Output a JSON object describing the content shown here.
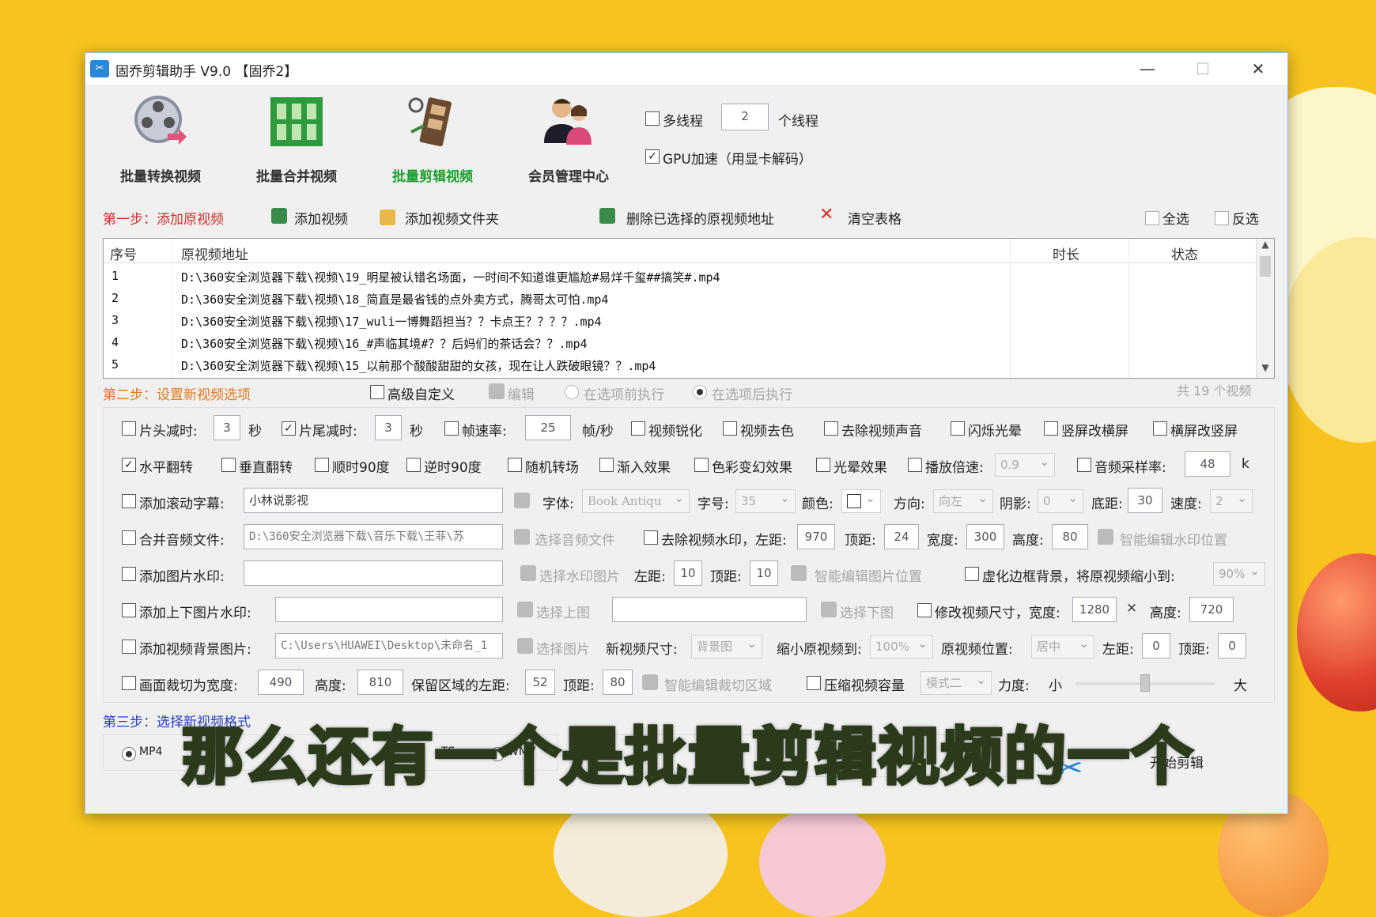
{
  "window": {
    "title": "固乔剪辑助手 V9.0 【固乔2】",
    "minimize": "—",
    "maximize": "☐",
    "close": "✕"
  },
  "toolbar": {
    "convert": "批量转换视频",
    "merge": "批量合并视频",
    "edit": "批量剪辑视频",
    "member": "会员管理中心",
    "multithread": "多线程",
    "threads": "2",
    "threads_unit": "个线程",
    "gpu": "GPU加速（用显卡解码）"
  },
  "step1": {
    "label": "第一步：添加原视频",
    "add_video": "添加视频",
    "add_folder": "添加视频文件夹",
    "delete_selected": "删除已选择的原视频地址",
    "clear_table": "清空表格",
    "select_all": "全选",
    "invert": "反选"
  },
  "table": {
    "headers": [
      "序号",
      "原视频地址",
      "时长",
      "状态"
    ],
    "rows": [
      {
        "no": "1",
        "path": "D:\\360安全浏览器下载\\视频\\19_明星被认错名场面，一时间不知道谁更尴尬#易烊千玺##搞笑#.mp4"
      },
      {
        "no": "2",
        "path": "D:\\360安全浏览器下载\\视频\\18_简直是最省钱的点外卖方式，腾哥太可怕.mp4"
      },
      {
        "no": "3",
        "path": "D:\\360安全浏览器下载\\视频\\17_wuli一博舞蹈担当？？卡点王？？？？.mp4"
      },
      {
        "no": "4",
        "path": "D:\\360安全浏览器下载\\视频\\16_#声临其境#？？后妈们的茶话会？？.mp4"
      },
      {
        "no": "5",
        "path": "D:\\360安全浏览器下载\\视频\\15_以前那个酸酸甜甜的女孩，现在让人跌破眼镜？？.mp4"
      }
    ]
  },
  "step2": {
    "label": "第二步：设置新视频选项",
    "advanced": "高级自定义",
    "edit": "编辑",
    "before": "在选项前执行",
    "after": "在选项后执行",
    "count": "共 19 个视频"
  },
  "opts": {
    "head_cut": "片头减时:",
    "head_val": "3",
    "sec1": "秒",
    "tail_cut": "片尾减时:",
    "tail_val": "3",
    "sec2": "秒",
    "fps": "帧速率:",
    "fps_val": "25",
    "fps_unit": "帧/秒",
    "sharpen": "视频锐化",
    "decolor": "视频去色",
    "mute": "去除视频声音",
    "flash": "闪烁光晕",
    "v2h": "竖屏改横屏",
    "h2v": "横屏改竖屏",
    "hflip": "水平翻转",
    "vflip": "垂直翻转",
    "cw90": "顺时90度",
    "ccw90": "逆时90度",
    "random_trans": "随机转场",
    "fade": "渐入效果",
    "color_fx": "色彩变幻效果",
    "light_fx": "光晕效果",
    "speed": "播放倍速:",
    "speed_val": "0.9",
    "sample": "音频采样率:",
    "sample_val": "48",
    "k": "k",
    "scroll_text": "添加滚动字幕:",
    "scroll_val": "小林说影视",
    "font": "字体:",
    "font_val": "Book Antiqu",
    "size": "字号:",
    "size_val": "35",
    "color": "颜色:",
    "dir": "方向:",
    "dir_val": "向左",
    "shadow": "阴影:",
    "shadow_val": "0",
    "bottom": "底距:",
    "bottom_val": "30",
    "speed2": "速度:",
    "speed2_val": "2",
    "merge_audio": "合并音频文件:",
    "audio_path": "D:\\360安全浏览器下载\\音乐下载\\王菲\\苏",
    "choose_audio": "选择音频文件",
    "remove_wm": "去除视频水印，左距:",
    "wm_left": "970",
    "top": "顶距:",
    "wm_top": "24",
    "width": "宽度:",
    "wm_w": "300",
    "height": "高度:",
    "wm_h": "80",
    "smart_wm": "智能编辑水印位置",
    "img_wm": "添加图片水印:",
    "choose_wm_img": "选择水印图片",
    "left": "左距:",
    "img_left": "10",
    "top2": "顶距:",
    "img_top": "10",
    "smart_img": "智能编辑图片位置",
    "blur_bg": "虚化边框背景，将原视频缩小到:",
    "blur_val": "90%",
    "topbottom_wm": "添加上下图片水印:",
    "choose_top": "选择上图",
    "choose_bottom": "选择下图",
    "resize": "修改视频尺寸，宽度:",
    "resize_w": "1280",
    "x": "×",
    "height2": "高度:",
    "resize_h": "720",
    "bg_img": "添加视频背景图片:",
    "bg_path": "C:\\Users\\HUAWEI\\Desktop\\未命名_1",
    "choose_img": "选择图片",
    "new_size": "新视频尺寸:",
    "new_size_val": "背景图",
    "shrink": "缩小原视频到:",
    "shrink_val": "100%",
    "orig_pos": "原视频位置:",
    "orig_pos_val": "居中",
    "left2": "左距:",
    "pos_left": "0",
    "top3": "顶距:",
    "pos_top": "0",
    "crop": "画面裁切为宽度:",
    "crop_w": "490",
    "height3": "高度:",
    "crop_h": "810",
    "keep_left": "保留区域的左距:",
    "keep_left_val": "52",
    "top4": "顶距:",
    "keep_top": "80",
    "smart_crop": "智能编辑裁切区域",
    "compress": "压缩视频容量",
    "mode_val": "模式二",
    "force": "力度:",
    "small": "小",
    "big": "大"
  },
  "step3": {
    "label": "第三步：选择新视频格式",
    "mp4": "MP4",
    "ts": "TS",
    "wmv": "WMV",
    "start": "开始剪辑"
  },
  "subtitle": "那么还有一个是批量剪辑视频的一个"
}
